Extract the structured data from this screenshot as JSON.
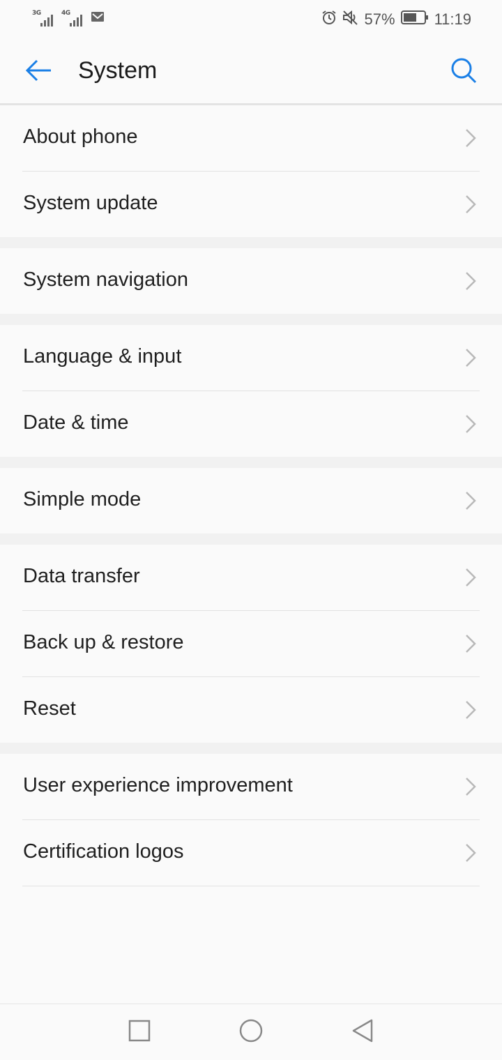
{
  "status_bar": {
    "sim1_network": "3G",
    "sim2_network": "4G",
    "battery_percent": "57%",
    "time": "11:19"
  },
  "header": {
    "title": "System"
  },
  "groups": [
    {
      "items": [
        {
          "label": "About phone"
        },
        {
          "label": "System update"
        }
      ]
    },
    {
      "items": [
        {
          "label": "System navigation"
        }
      ]
    },
    {
      "items": [
        {
          "label": "Language & input"
        },
        {
          "label": "Date & time"
        }
      ]
    },
    {
      "items": [
        {
          "label": "Simple mode"
        }
      ]
    },
    {
      "items": [
        {
          "label": "Data transfer"
        },
        {
          "label": "Back up & restore"
        },
        {
          "label": "Reset"
        }
      ]
    },
    {
      "items": [
        {
          "label": "User experience improvement"
        },
        {
          "label": "Certification logos"
        }
      ]
    }
  ],
  "colors": {
    "accent": "#1a7fe6",
    "text": "#1f1f1f",
    "chevron": "#b8b8b8"
  },
  "icons": {
    "back": "arrow-left-icon",
    "search": "search-icon",
    "chevron": "chevron-right-icon",
    "nav_recent": "square-icon",
    "nav_home": "circle-icon",
    "nav_back": "triangle-icon"
  }
}
